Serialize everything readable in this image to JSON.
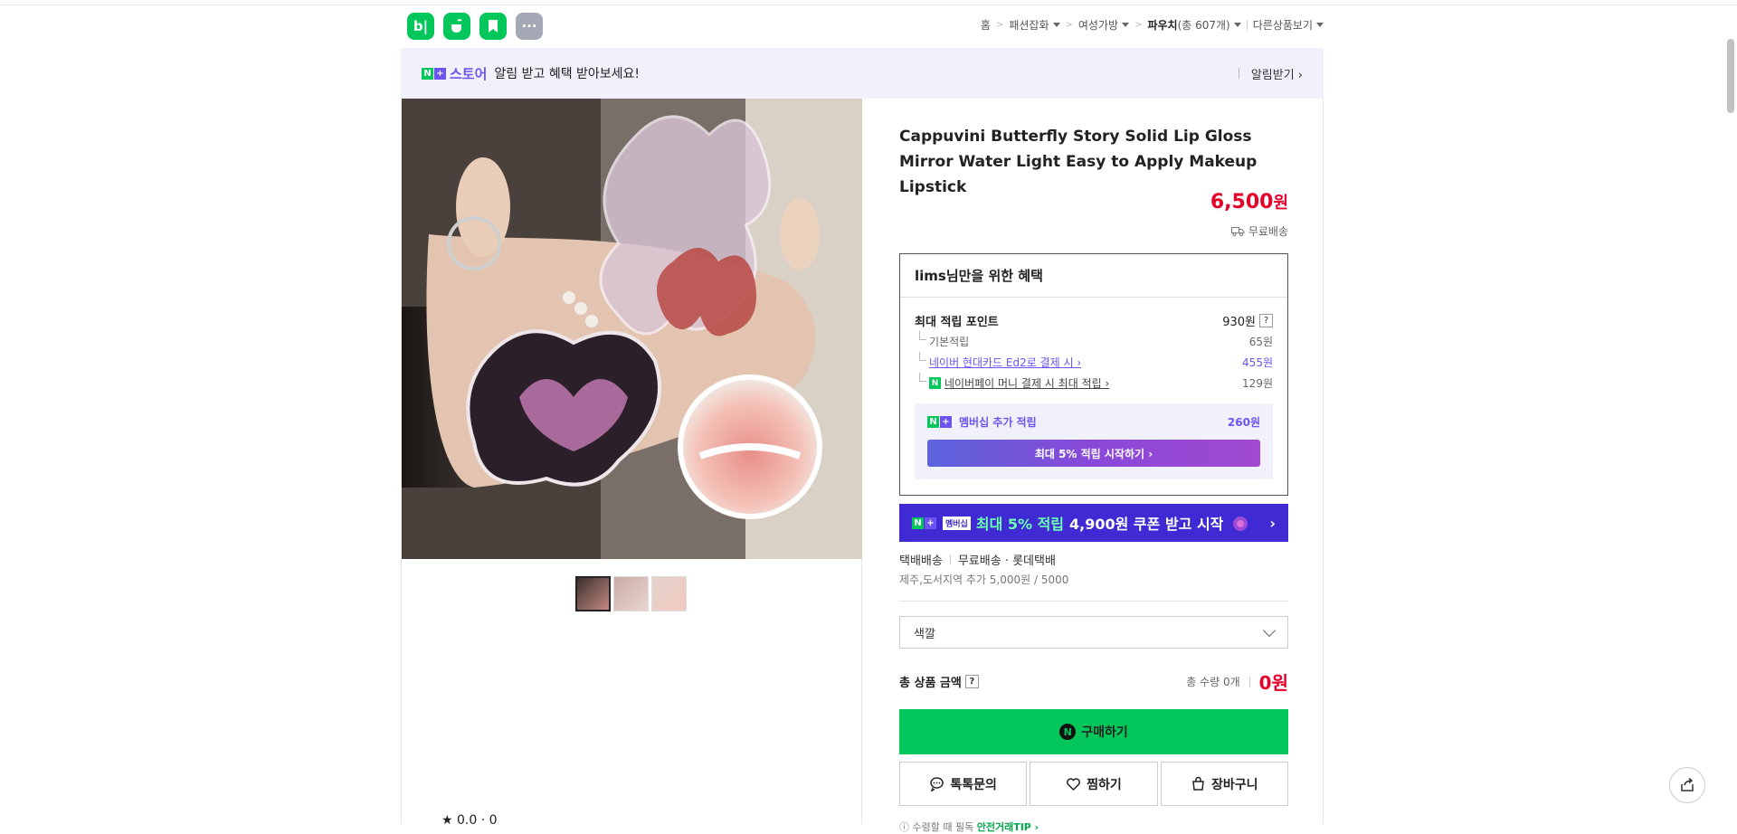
{
  "apps": [
    {
      "name": "blog-icon",
      "label": "b|"
    },
    {
      "name": "cafe-icon",
      "label": ""
    },
    {
      "name": "bookmark-icon",
      "label": ""
    },
    {
      "name": "more-icon",
      "label": "···"
    }
  ],
  "breadcrumb": {
    "home": "홈",
    "c1": "패션잡화",
    "c2": "여성가방",
    "c3": "파우치",
    "c3_count": "(총 607개)",
    "other": "다른상품보기"
  },
  "notify": {
    "n": "N",
    "plus": "+",
    "store": "스토어",
    "text": "알림 받고 혜택 받아보세요!",
    "action": "알림받기 ›"
  },
  "product": {
    "title": "Cappuvini Butterfly Story Solid Lip Gloss Mirror Water Light Easy to Apply Makeup Lipstick",
    "price": "6,500",
    "price_unit": "원",
    "shipping": "무료배송"
  },
  "benefit": {
    "header": "lims님만을 위한 혜택",
    "max_label": "최대 적립 포인트",
    "max_value": "930원",
    "q": "?",
    "rows": [
      {
        "label": "기본적립",
        "value": "65원"
      },
      {
        "label": "네이버 현대카드 Ed2로 결제 시 ›",
        "value": "455원"
      },
      {
        "label": "네이버페이 머니 결제 시 최대 적립 ›",
        "value": "129원"
      }
    ],
    "member_label": "멤버십 추가 적립",
    "member_value": "260원",
    "member_cta": "최대 5% 적립 시작하기 ›"
  },
  "promo": {
    "tag": "멤버십",
    "green": "최대 5% 적립",
    "white": "4,900원 쿠폰 받고 시작",
    "arrow": "›"
  },
  "delivery": {
    "type": "택배배송",
    "free": "무료배송",
    "courier": "· 롯데택배",
    "extra": "제주,도서지역 추가 5,000원 / 5000"
  },
  "option": {
    "placeholder": "색깔"
  },
  "total": {
    "label": "총 상품 금액",
    "qty": "총 수량 0개",
    "amount": "0원"
  },
  "actions": {
    "buy": "구매하기",
    "talk": "톡톡문의",
    "wish": "찜하기",
    "cart": "장바구니"
  },
  "tip": {
    "text": "ⓘ 수령할 때 필독",
    "link": "안전거래TIP ›"
  },
  "rating": {
    "text": "★ 0.0 · 0"
  },
  "colors": {
    "naver_green": "#03c75a",
    "price_red": "#e3002b",
    "store_purple": "#6c53f2",
    "promo_blue": "#3f2ad3"
  }
}
